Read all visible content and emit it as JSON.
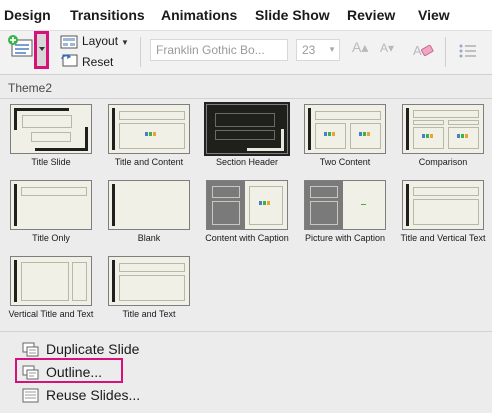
{
  "ribbon": {
    "tabs": [
      "Design",
      "Transitions",
      "Animations",
      "Slide Show",
      "Review",
      "View"
    ],
    "layout_label": "Layout",
    "reset_label": "Reset",
    "font_name": "Franklin Gothic Bo...",
    "font_size": "23",
    "grow_font": "A▴",
    "shrink_font": "A▾"
  },
  "gallery": {
    "theme_name": "Theme2",
    "layouts": [
      {
        "label": "Title Slide"
      },
      {
        "label": "Title and Content"
      },
      {
        "label": "Section Header"
      },
      {
        "label": "Two Content"
      },
      {
        "label": "Comparison"
      },
      {
        "label": "Title Only"
      },
      {
        "label": "Blank"
      },
      {
        "label": "Content with Caption"
      },
      {
        "label": "Picture with Caption"
      },
      {
        "label": "Title and Vertical Text"
      },
      {
        "label": "Vertical Title and Text"
      },
      {
        "label": "Title and Text"
      }
    ]
  },
  "menu": {
    "duplicate_slide": "Duplicate Slide",
    "outline": "Outline...",
    "reuse_slides": "Reuse Slides..."
  },
  "colors": {
    "highlight": "#d6127a",
    "thumb_bg": "#f0f0e6",
    "thumb_dark": "#1f1f1b"
  }
}
